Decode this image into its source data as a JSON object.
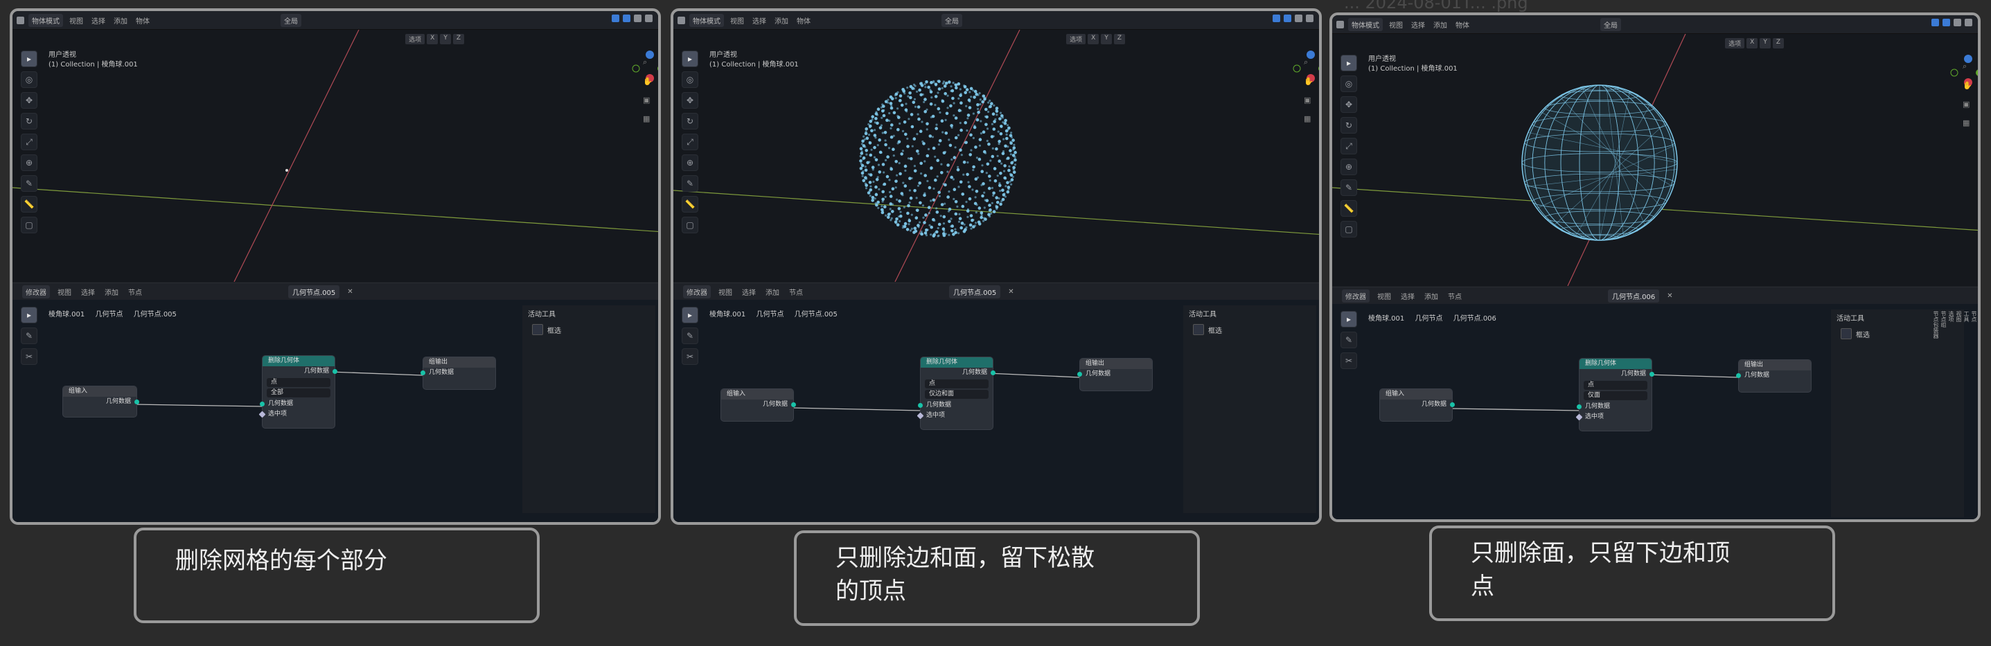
{
  "ghost_text": "... 2024-08-01T... .png",
  "header": {
    "mode_label": "物体模式",
    "menus": [
      "视图",
      "选择",
      "添加",
      "物体"
    ],
    "global_label": "全局",
    "select_label": "选项",
    "axes": [
      "X",
      "Y",
      "Z"
    ]
  },
  "viewport": {
    "info_line1": "用户透视",
    "info_line2": "(1) Collection | 棱角球.001"
  },
  "node_editor": {
    "editor_type": "修改器",
    "menus": [
      "视图",
      "选择",
      "添加",
      "节点"
    ],
    "tree_name": "几何节点.005",
    "breadcrumbs": [
      "棱角球.001",
      "几何节点",
      "几何节点.005"
    ],
    "group_input_title": "组输入",
    "group_output_title": "组输出",
    "geometry_label": "几何数据",
    "delete_node_title": "删除几何体",
    "selection_label": "选中项",
    "domain_value": "点",
    "sidebar_title": "活动工具",
    "sidebar_item": "框选",
    "tabs": [
      "节点",
      "工具",
      "视图",
      "选项",
      "节点组",
      "节点包装器"
    ]
  },
  "panels": [
    {
      "mode_value": "全部",
      "tree_name": "几何节点.005",
      "breadcrumb_last": "几何节点.005"
    },
    {
      "mode_value": "仅边和面",
      "tree_name": "几何节点.005",
      "breadcrumb_last": "几何节点.005"
    },
    {
      "mode_value": "仅面",
      "tree_name": "几何节点.006",
      "breadcrumb_last": "几何节点.006"
    }
  ],
  "captions": [
    "删除网格的每个部分",
    "只删除边和面，留下松散\n的顶点",
    "只删除面，只留下边和顶\n点"
  ],
  "colors": {
    "node_socket": "#19c2a8",
    "node_header_geometry": "#1f6f6a",
    "node_header_group": "#3a3d44",
    "x_axis": "#b04a55",
    "y_axis": "#7f9b3c",
    "sphere_point": "#7ec8ea"
  }
}
